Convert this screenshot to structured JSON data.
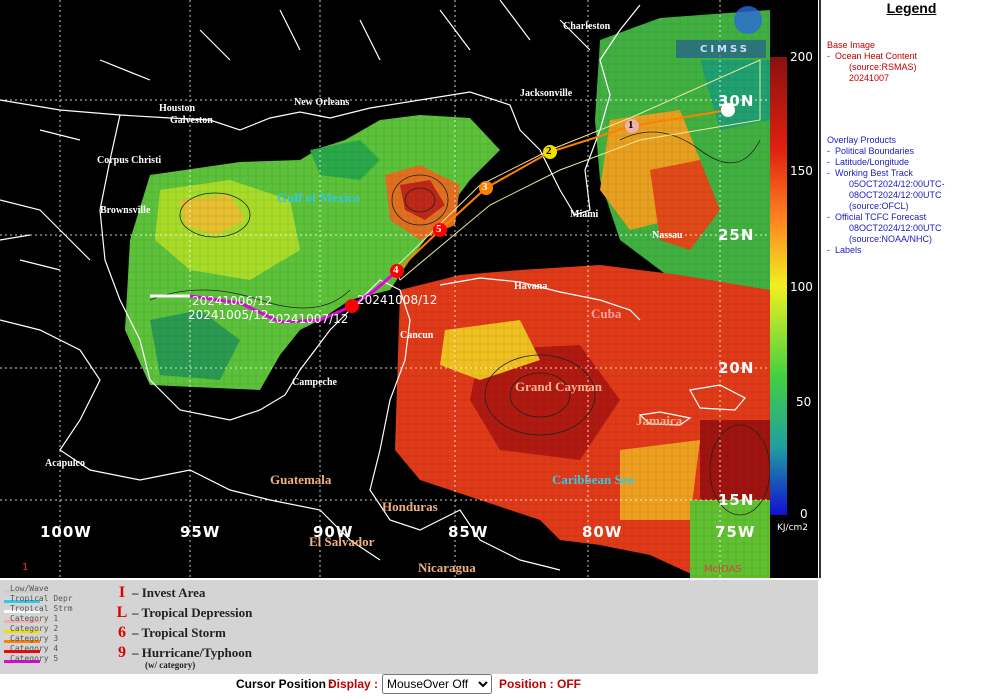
{
  "map": {
    "base_colors": {
      "ocean": "#000000",
      "low": "#2a8a3c",
      "mid": "#9ad830",
      "high": "#e6e020",
      "hot": "#e0401a",
      "peak": "#a01010"
    },
    "city_labels": [
      {
        "id": "charleston",
        "text": "Charleston"
      },
      {
        "id": "houston",
        "text": "Houston"
      },
      {
        "id": "galveston",
        "text": "Galveston"
      },
      {
        "id": "new-orleans",
        "text": "New Orleans"
      },
      {
        "id": "jacksonville",
        "text": "Jacksonville"
      },
      {
        "id": "corpus-christi",
        "text": "Corpus Christi"
      },
      {
        "id": "brownsville",
        "text": "Brownsville"
      },
      {
        "id": "miami",
        "text": "Miami"
      },
      {
        "id": "nassau",
        "text": "Nassau"
      },
      {
        "id": "havana",
        "text": "Havana"
      },
      {
        "id": "cancun",
        "text": "Cancun"
      },
      {
        "id": "campeche",
        "text": "Campeche"
      },
      {
        "id": "acapulco",
        "text": "Acapulco"
      }
    ],
    "region_labels": [
      {
        "id": "gulf",
        "text": "Gulf of Mexico"
      },
      {
        "id": "cuba",
        "text": "Cuba"
      },
      {
        "id": "grand-cayman",
        "text": "Grand Cayman"
      },
      {
        "id": "jamaica",
        "text": "Jamaica"
      },
      {
        "id": "caribbean",
        "text": "Caribbean Sea"
      },
      {
        "id": "guatemala",
        "text": "Guatemala"
      },
      {
        "id": "honduras",
        "text": "Honduras"
      },
      {
        "id": "el-salvador",
        "text": "El Salvador"
      },
      {
        "id": "nicaragua",
        "text": "Nicaragua"
      }
    ],
    "lat_labels": [
      "30N",
      "25N",
      "20N",
      "15N"
    ],
    "lon_labels": [
      "100W",
      "95W",
      "90W",
      "85W",
      "80W",
      "75W"
    ],
    "track_dates": [
      "20241006/12",
      "20241005/12",
      "20241007/12",
      "20241008/12"
    ],
    "forecast_points": [
      "1",
      "2",
      "3",
      "4",
      "5"
    ],
    "frame_number": "1",
    "mcidas": "McIDAS",
    "cimss": "CIMSS",
    "colorbar": {
      "ticks": [
        "200",
        "150",
        "100",
        "50",
        "0"
      ],
      "unit": "KJ/cm2"
    }
  },
  "legend": {
    "title": "Legend",
    "base_heading": "Base Image",
    "base_item": "Ocean Heat Content",
    "base_source": "(source:RSMAS)",
    "base_date": "20241007",
    "overlay_heading": "Overlay Products",
    "overlay_items": [
      "Political Boundaries",
      "Latitude/Longitude",
      "Working Best Track"
    ],
    "best_track_range_1": "05OCT2024/12:00UTC-",
    "best_track_range_2": "08OCT2024/12:00UTC",
    "best_track_source": "(source:OFCL)",
    "forecast_item": "Official TCFC Forecast",
    "forecast_time": "08OCT2024/12:00UTC",
    "forecast_source": "(source:NOAA/NHC)",
    "labels_item": "Labels"
  },
  "track_legend": [
    {
      "label": "Low/Wave",
      "color": "#cccccc"
    },
    {
      "label": "Tropical Depr",
      "color": "#30c8e8"
    },
    {
      "label": "Tropical Strm",
      "color": "#ffffff"
    },
    {
      "label": "Category 1",
      "color": "#f0b0b0"
    },
    {
      "label": "Category 2",
      "color": "#f0e000"
    },
    {
      "label": "Category 3",
      "color": "#ff8000"
    },
    {
      "label": "Category 4",
      "color": "#ff0000"
    },
    {
      "label": "Category 5",
      "color": "#e000e0"
    }
  ],
  "symbol_legend": [
    {
      "symbol": "I",
      "label": "– Invest Area"
    },
    {
      "symbol": "L",
      "label": "– Tropical Depression"
    },
    {
      "symbol": "6",
      "label": "– Tropical Storm"
    },
    {
      "symbol": "9",
      "label": "– Hurricane/Typhoon"
    }
  ],
  "symbol_note": "(w/ category)",
  "status": {
    "cursor_label": "Cursor Position :",
    "display_label": "Display :",
    "display_selected": "MouseOver Off",
    "position_label": "Position : OFF"
  }
}
